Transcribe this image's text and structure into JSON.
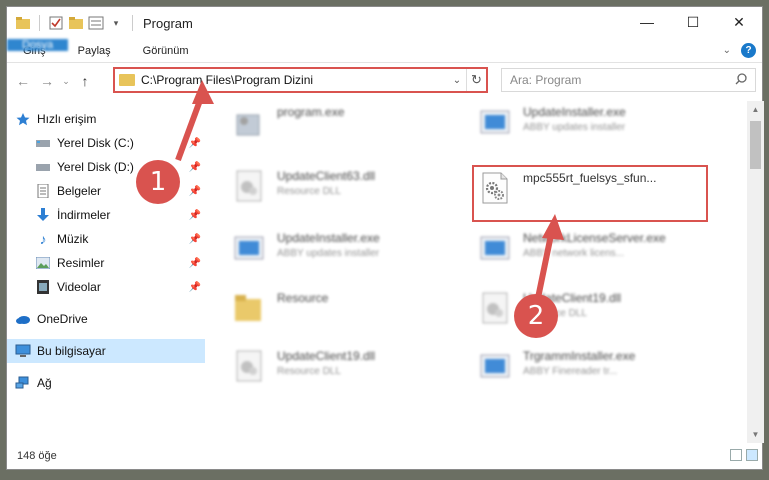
{
  "window": {
    "title": "Program",
    "controls": {
      "minimize": "—",
      "maximize": "☐",
      "close": "✕"
    }
  },
  "ribbon": {
    "tabs": [
      {
        "label": "Dosya"
      },
      {
        "label": "Giriş"
      },
      {
        "label": "Paylaş"
      },
      {
        "label": "Görünüm"
      }
    ],
    "help": "?"
  },
  "navigation": {
    "address_path": "C:\\Program Files\\Program Dizini",
    "search_placeholder": "Ara: Program"
  },
  "sidebar": {
    "items": [
      {
        "label": "Hızlı erişim",
        "icon": "star-icon"
      },
      {
        "label": "Yerel Disk (C:)",
        "icon": "drive-icon",
        "pinned": true
      },
      {
        "label": "Yerel Disk (D:)",
        "icon": "drive-icon",
        "pinned": true
      },
      {
        "label": "Belgeler",
        "icon": "documents-icon",
        "pinned": true
      },
      {
        "label": "İndirmeler",
        "icon": "download-icon",
        "pinned": true
      },
      {
        "label": "Müzik",
        "icon": "music-icon",
        "pinned": true
      },
      {
        "label": "Resimler",
        "icon": "pictures-icon",
        "pinned": true
      },
      {
        "label": "Videolar",
        "icon": "video-icon",
        "pinned": true
      },
      {
        "label": "OneDrive",
        "icon": "cloud-icon"
      },
      {
        "label": "Bu bilgisayar",
        "icon": "computer-icon",
        "selected": true
      },
      {
        "label": "Ağ",
        "icon": "network-icon"
      }
    ]
  },
  "files": [
    {
      "name": "program.exe",
      "sub": "",
      "icon": "app-icon"
    },
    {
      "name": "UpdateInstaller.exe",
      "sub": "ABBY updates installer",
      "icon": "installer-icon"
    },
    {
      "name": "UpdateClient63.dll",
      "sub": "Resource DLL",
      "icon": "dll-icon"
    },
    {
      "name": "mpc555rt_fuelsys_sfun...",
      "sub": "",
      "icon": "dll-icon"
    },
    {
      "name": "UpdateInstaller.exe",
      "sub": "ABBY updates installer",
      "icon": "installer-icon"
    },
    {
      "name": "NetworkLicenseServer.exe",
      "sub": "ABBY network licens...",
      "icon": "installer-icon"
    },
    {
      "name": "Resource",
      "sub": "",
      "icon": "folder-icon"
    },
    {
      "name": "UpdateClient19.dll",
      "sub": "Resource DLL",
      "icon": "dll-icon"
    },
    {
      "name": "UpdateClient19.dll",
      "sub": "Resource DLL",
      "icon": "dll-icon"
    },
    {
      "name": "TrgrammInstaller.exe",
      "sub": "ABBY Finereader tr...",
      "icon": "installer-icon"
    }
  ],
  "status": {
    "count": "148 öğe"
  },
  "callouts": {
    "one": "1",
    "two": "2"
  },
  "colors": {
    "accent": "#1979ca",
    "highlight": "#d9534f"
  }
}
